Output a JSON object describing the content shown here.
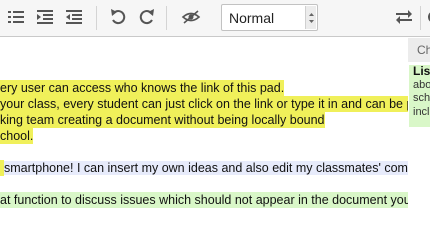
{
  "toolbar": {
    "style_select": {
      "value": "Normal"
    },
    "icons": [
      "list-icon",
      "indent-icon",
      "outdent-icon",
      "undo-icon",
      "redo-icon",
      "authorship-colors-icon",
      "import-export-icon"
    ]
  },
  "editor": {
    "lines": [
      {
        "text": "ery user can access who knows the link of this pad.",
        "highlight": "#f0f05a"
      },
      {
        "text": "your class, every student can just click on the link or type it in and can be part",
        "highlight": "#f0f05a"
      },
      {
        "text": "king team creating a document without being locally bound",
        "highlight": "#f0f05a"
      },
      {
        "text": "chool.",
        "highlight": "#f0f05a"
      },
      {
        "text": "smartphone! I can insert my own ideas and also edit my classmates' commer",
        "highlight": "#e7ebfb"
      },
      {
        "text": "at function to discuss issues which should not appear in the document you are",
        "highlight": "#d9f7c8"
      }
    ],
    "first_line_prefix_highlight": "#f0f05a"
  },
  "chat": {
    "header": "Ch",
    "message": {
      "title": "Lis",
      "lines": [
        "abo",
        "sch",
        "incl"
      ]
    }
  }
}
